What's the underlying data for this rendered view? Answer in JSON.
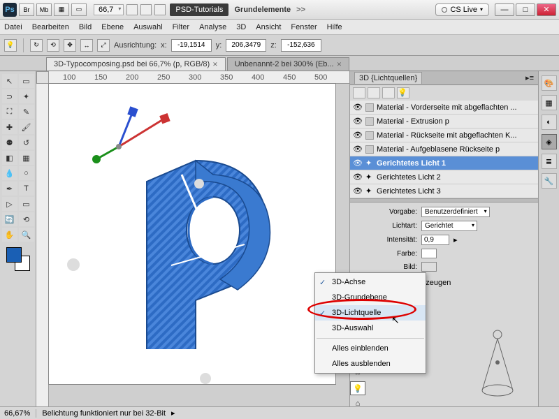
{
  "title": {
    "ps": "Ps",
    "btn_br": "Br",
    "btn_mb": "Mb",
    "zoom": "66,7",
    "tag": "PSD-Tutorials",
    "doc": "Grundelemente",
    "arrow": ">>",
    "cslive": "CS Live"
  },
  "menu": [
    "Datei",
    "Bearbeiten",
    "Bild",
    "Ebene",
    "Auswahl",
    "Filter",
    "Analyse",
    "3D",
    "Ansicht",
    "Fenster",
    "Hilfe"
  ],
  "optbar": {
    "align_label": "Ausrichtung:",
    "x_label": "x:",
    "x_val": "-19,1514",
    "y_label": "y:",
    "y_val": "206,3479",
    "z_label": "z:",
    "z_val": "-152,636"
  },
  "tabs": [
    {
      "label": "3D-Typocomposing.psd bei 66,7% (p, RGB/8)",
      "active": true
    },
    {
      "label": "Unbenannt-2 bei 300% (Eb...",
      "active": false
    }
  ],
  "ruler_marks": [
    "100",
    "150",
    "200",
    "250",
    "300",
    "350",
    "400",
    "450",
    "500"
  ],
  "panel3d": {
    "title": "3D {Lichtquellen}",
    "layers": [
      {
        "eye": "👁",
        "label": "Material - Vorderseite mit abgeflachten ...",
        "type": "mat"
      },
      {
        "eye": "👁",
        "label": "Material - Extrusion p",
        "type": "mat"
      },
      {
        "eye": "👁",
        "label": "Material - Rückseite mit abgeflachten K...",
        "type": "mat"
      },
      {
        "eye": "👁",
        "label": "Material - Aufgeblasene Rückseite p",
        "type": "mat"
      },
      {
        "eye": "👁",
        "label": "Gerichtetes Licht 1",
        "type": "light",
        "sel": true
      },
      {
        "eye": "👁",
        "label": "Gerichtetes Licht 2",
        "type": "light"
      },
      {
        "eye": "👁",
        "label": "Gerichtetes Licht 3",
        "type": "light"
      }
    ]
  },
  "props": {
    "vorgabe_label": "Vorgabe:",
    "vorgabe_val": "Benutzerdefiniert",
    "lichtart_label": "Lichtart:",
    "lichtart_val": "Gerichtet",
    "intensitat_label": "Intensität:",
    "intensitat_val": "0,9",
    "farbe_label": "Farbe:",
    "bild_label": "Bild:",
    "schatten_label": "Schatten erzeugen"
  },
  "context": {
    "items": [
      {
        "label": "3D-Achse",
        "checked": true
      },
      {
        "label": "3D-Grundebene",
        "checked": false
      },
      {
        "label": "3D-Lichtquelle",
        "checked": true,
        "hover": true
      },
      {
        "label": "3D-Auswahl",
        "checked": false
      }
    ],
    "sep_after": 3,
    "items2": [
      {
        "label": "Alles einblenden"
      },
      {
        "label": "Alles ausblenden"
      }
    ]
  },
  "status": {
    "zoom": "66,67%",
    "msg": "Belichtung funktioniert nur bei 32-Bit"
  }
}
